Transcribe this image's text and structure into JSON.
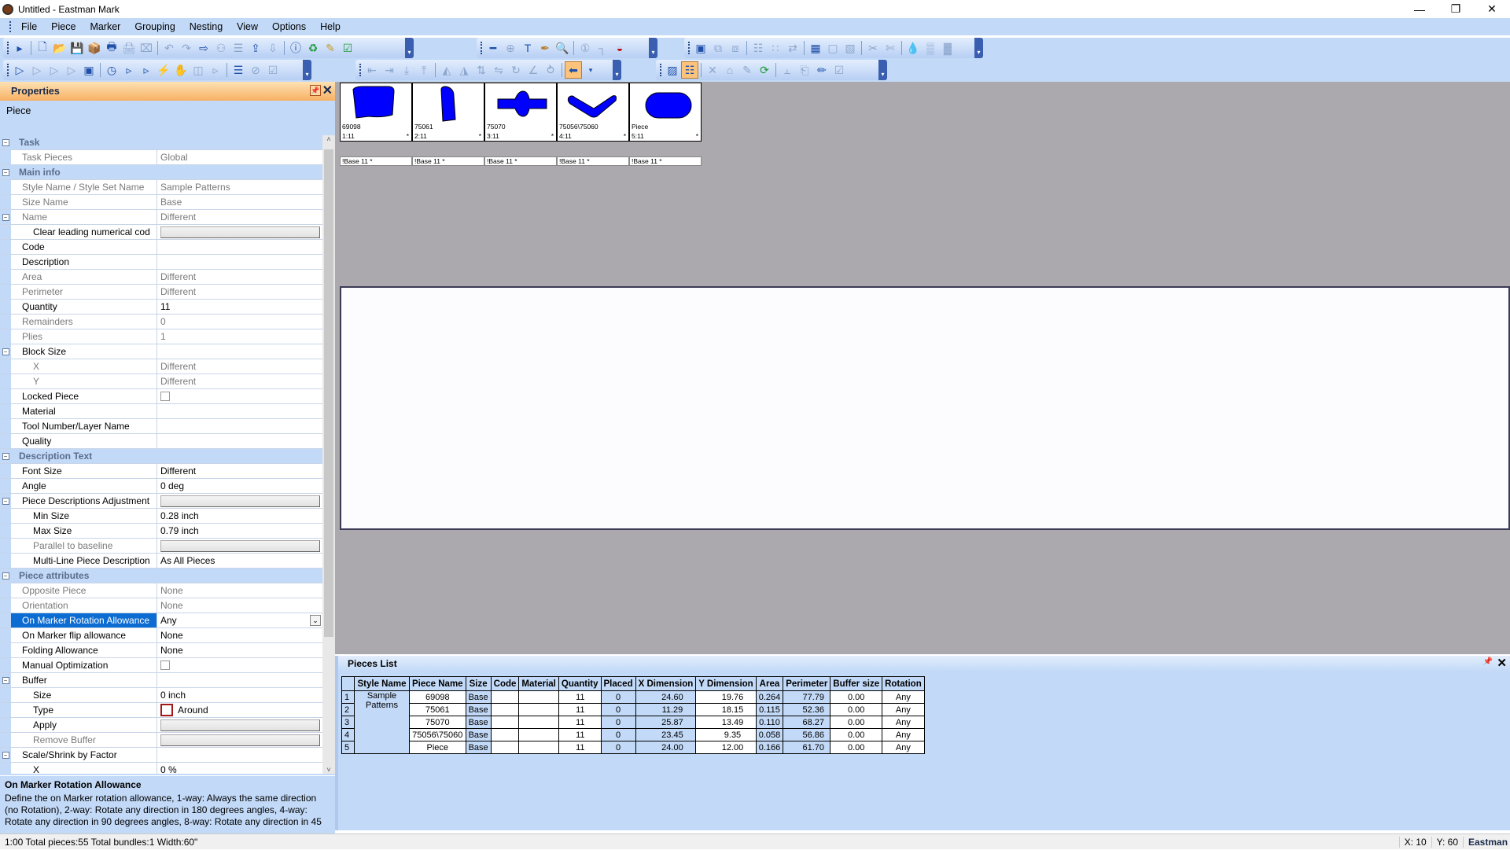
{
  "window": {
    "title": "Untitled - Eastman Mark"
  },
  "menu": [
    "File",
    "Piece",
    "Marker",
    "Grouping",
    "Nesting",
    "View",
    "Options",
    "Help"
  ],
  "properties": {
    "title": "Properties",
    "object": "Piece",
    "rows": [
      {
        "type": "cat",
        "name": "Task"
      },
      {
        "name": "Task Pieces",
        "value": "Global",
        "indent": 1,
        "gray": true
      },
      {
        "type": "cat",
        "name": "Main info"
      },
      {
        "name": "Style Name / Style Set Name",
        "value": "Sample Patterns",
        "indent": 1,
        "gray": true
      },
      {
        "name": "Size Name",
        "value": "Base",
        "indent": 1,
        "gray": true
      },
      {
        "name": "Name",
        "value": "Different",
        "indent": 1,
        "gray": true,
        "toggle": true
      },
      {
        "name": "Clear leading numerical cod",
        "value": "",
        "indent": 2,
        "button": true
      },
      {
        "name": "Code",
        "value": "",
        "indent": 1
      },
      {
        "name": "Description",
        "value": "",
        "indent": 1
      },
      {
        "name": "Area",
        "value": "Different",
        "indent": 1,
        "gray": true
      },
      {
        "name": "Perimeter",
        "value": "Different",
        "indent": 1,
        "gray": true
      },
      {
        "name": "Quantity",
        "value": "11",
        "indent": 1
      },
      {
        "name": "Remainders",
        "value": "0",
        "indent": 1,
        "gray": true
      },
      {
        "name": "Plies",
        "value": "1",
        "indent": 1,
        "gray": true
      },
      {
        "name": "Block Size",
        "value": "",
        "indent": 1,
        "toggle": true
      },
      {
        "name": "X",
        "value": "Different",
        "indent": 2,
        "gray": true
      },
      {
        "name": "Y",
        "value": "Different",
        "indent": 2,
        "gray": true
      },
      {
        "name": "Locked Piece",
        "value": "",
        "indent": 1,
        "checkbox": true
      },
      {
        "name": "Material",
        "value": "",
        "indent": 1
      },
      {
        "name": "Tool Number/Layer Name",
        "value": "",
        "indent": 1
      },
      {
        "name": "Quality",
        "value": "",
        "indent": 1
      },
      {
        "type": "cat",
        "name": "Description Text"
      },
      {
        "name": "Font Size",
        "value": "Different",
        "indent": 1
      },
      {
        "name": "Angle",
        "value": "0 deg",
        "indent": 1
      },
      {
        "name": "Piece Descriptions Adjustment",
        "value": "",
        "indent": 1,
        "toggle": true,
        "button": true
      },
      {
        "name": "Min Size",
        "value": "0.28 inch",
        "indent": 2
      },
      {
        "name": "Max Size",
        "value": "0.79 inch",
        "indent": 2
      },
      {
        "name": "Parallel to baseline",
        "value": "",
        "indent": 2,
        "gray": true,
        "button": true
      },
      {
        "name": "Multi-Line Piece Description",
        "value": "As All Pieces",
        "indent": 2
      },
      {
        "type": "cat",
        "name": "Piece attributes"
      },
      {
        "name": "Opposite Piece",
        "value": "None",
        "indent": 1,
        "gray": true
      },
      {
        "name": "Orientation",
        "value": "None",
        "indent": 1,
        "gray": true
      },
      {
        "name": "On Marker Rotation Allowance",
        "value": "Any",
        "indent": 1,
        "selected": true,
        "dropdown": true
      },
      {
        "name": "On Marker flip allowance",
        "value": "None",
        "indent": 1
      },
      {
        "name": "Folding Allowance",
        "value": "None",
        "indent": 1
      },
      {
        "name": "Manual Optimization",
        "value": "",
        "indent": 1,
        "checkbox": true
      },
      {
        "name": "Buffer",
        "value": "",
        "indent": 1,
        "toggle": true
      },
      {
        "name": "Size",
        "value": "0 inch",
        "indent": 2
      },
      {
        "name": "Type",
        "value": "Around",
        "indent": 2,
        "color": true
      },
      {
        "name": "Apply",
        "value": "",
        "indent": 2,
        "button": true
      },
      {
        "name": "Remove Buffer",
        "value": "",
        "indent": 2,
        "gray": true,
        "button": true
      },
      {
        "name": "Scale/Shrink by Factor",
        "value": "",
        "indent": 1,
        "toggle": true
      },
      {
        "name": "X",
        "value": "0 %",
        "indent": 2
      }
    ],
    "help_title": "On Marker Rotation Allowance",
    "help_text": "Define the on Marker rotation allowance, 1-way: Always the same direction (no Rotation), 2-way: Rotate any direction in 180 degrees angles, 4-way: Rotate any direction in 90 degrees angles, 8-way: Rotate any direction in 45"
  },
  "pieces": [
    {
      "name": "69098",
      "count": "1:11",
      "shape": "seat",
      "base": "!Base 11  *"
    },
    {
      "name": "75061",
      "count": "2:11",
      "shape": "tall",
      "base": "!Base 11  *"
    },
    {
      "name": "75070",
      "count": "3:11",
      "shape": "cross",
      "base": "!Base 11  *"
    },
    {
      "name": "75056\\75060",
      "count": "4:11",
      "shape": "chevron",
      "base": "!Base 11  *"
    },
    {
      "name": "Piece",
      "count": "5:11",
      "shape": "oval",
      "base": "!Base 11  *"
    }
  ],
  "piece_fill": "#0000ff",
  "pieces_list": {
    "title": "Pieces List",
    "columns": [
      "",
      "Style Name",
      "Piece Name",
      "Size",
      "Code",
      "Material",
      "Quantity",
      "Placed",
      "X Dimension",
      "Y Dimension",
      "Area",
      "Perimeter",
      "Buffer size",
      "Rotation"
    ],
    "style_name": "Sample Patterns",
    "rows": [
      {
        "n": "1",
        "piece": "69098",
        "size": "Base",
        "code": "",
        "material": "",
        "qty": "11",
        "placed": "0",
        "x": "24.60",
        "y": "19.76",
        "area": "0.264",
        "per": "77.79",
        "buf": "0.00",
        "rot": "Any"
      },
      {
        "n": "2",
        "piece": "75061",
        "size": "Base",
        "code": "",
        "material": "",
        "qty": "11",
        "placed": "0",
        "x": "11.29",
        "y": "18.15",
        "area": "0.115",
        "per": "52.36",
        "buf": "0.00",
        "rot": "Any"
      },
      {
        "n": "3",
        "piece": "75070",
        "size": "Base",
        "code": "",
        "material": "",
        "qty": "11",
        "placed": "0",
        "x": "25.87",
        "y": "13.49",
        "area": "0.110",
        "per": "68.27",
        "buf": "0.00",
        "rot": "Any"
      },
      {
        "n": "4",
        "piece": "75056\\75060",
        "size": "Base",
        "code": "",
        "material": "",
        "qty": "11",
        "placed": "0",
        "x": "23.45",
        "y": "9.35",
        "area": "0.058",
        "per": "56.86",
        "buf": "0.00",
        "rot": "Any"
      },
      {
        "n": "5",
        "piece": "Piece",
        "size": "Base",
        "code": "",
        "material": "",
        "qty": "11",
        "placed": "0",
        "x": "24.00",
        "y": "12.00",
        "area": "0.166",
        "per": "61.70",
        "buf": "0.00",
        "rot": "Any"
      }
    ]
  },
  "status": {
    "left": "1:00  Total pieces:55  Total bundles:1  Width:60\"",
    "x": "X: 10",
    "y": "Y: 60",
    "brand": "Eastman"
  }
}
